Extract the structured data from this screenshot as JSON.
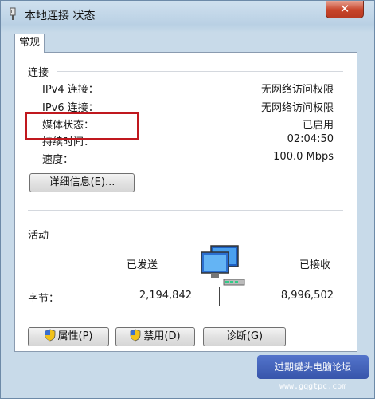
{
  "window": {
    "title": "本地连接 状态",
    "close_label": "✕"
  },
  "tab": {
    "label": "常规"
  },
  "connection": {
    "heading": "连接",
    "rows": [
      {
        "label": "IPv4 连接：",
        "value": "无网络访问权限"
      },
      {
        "label": "IPv6 连接：",
        "value": "无网络访问权限"
      },
      {
        "label": "媒体状态：",
        "value": "已启用"
      },
      {
        "label": "持续时间：",
        "value": "02:04:50"
      },
      {
        "label": "速度：",
        "value": "100.0 Mbps"
      }
    ],
    "details_button": "详细信息(E)..."
  },
  "activity": {
    "heading": "活动",
    "sent_label": "已发送",
    "received_label": "已接收",
    "bytes_label": "字节：",
    "bytes_sent": "2,194,842",
    "bytes_received": "8,996,502"
  },
  "buttons": {
    "properties": "属性(P)",
    "disable": "禁用(D)",
    "diagnose": "诊断(G)"
  },
  "watermark": {
    "text": "过期罐头电脑论坛",
    "url": "www.gqgtpc.com"
  }
}
